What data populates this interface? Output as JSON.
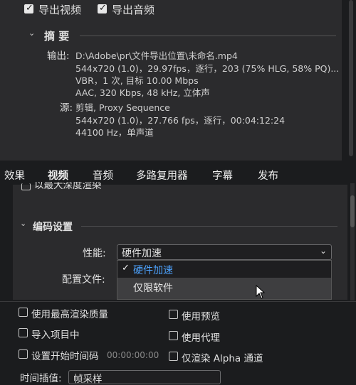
{
  "export": {
    "export_video_label": "导出视频",
    "export_audio_label": "导出音频",
    "summary_title": "摘 要",
    "output_label": "输出:",
    "output_path": "D:\\Adobe\\pr\\文件导出位置\\未命名.mp4",
    "output_line2": "544x720 (1.0)，29.97fps，逐行，203 (75% HLG, 58% PQ)...",
    "output_line3": "VBR，1 次, 目标 10.00 Mbps",
    "output_line4": "AAC, 320 Kbps, 48  kHz, 立体声",
    "source_label": "源:",
    "source_line1": "剪辑, Proxy Sequence",
    "source_line2": "544x720 (1.0)，27.766 fps，逐行，00:04:12:24",
    "source_line3": "44100 Hz，单声道"
  },
  "tabs": [
    "效果",
    "视频",
    "音频",
    "多路复用器",
    "字幕",
    "发布"
  ],
  "video": {
    "partial_label": "以最大深度渲染",
    "encoding_title": "编码设置",
    "performance_label": "性能:",
    "performance_value": "硬件加速",
    "profile_label": "配置文件:",
    "dropdown_options": [
      {
        "label": "硬件加速",
        "selected": true
      },
      {
        "label": "仅限软件",
        "selected": false
      }
    ]
  },
  "bottom": {
    "use_max_quality": "使用最高渲染质量",
    "use_preview": "使用预览",
    "import_into_project": "导入项目中",
    "use_proxy": "使用代理",
    "set_start_timecode": "设置开始时间码",
    "start_timecode_value": "00:00:00:00",
    "render_alpha_only": "仅渲染 Alpha 通道",
    "time_interpolation_label": "时间插值:",
    "time_interpolation_value": "帧采样"
  },
  "colors": {
    "dialog_bg": "#2b2b2d",
    "page_bg": "#1b1c1e",
    "selected_option": "#4da3ff",
    "accent": "#3a8ee6"
  }
}
